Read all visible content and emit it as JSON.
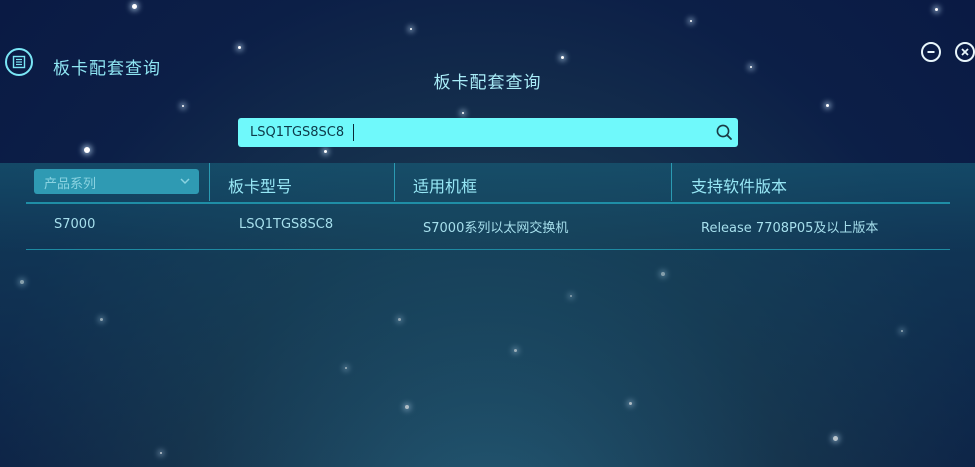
{
  "app": {
    "title": "板卡配套查询",
    "center_title": "板卡配套查询"
  },
  "search": {
    "value": "LSQ1TGS8SC8"
  },
  "filter": {
    "label": "产品系列"
  },
  "table": {
    "headers": [
      "板卡型号",
      "适用机框",
      "支持软件版本"
    ],
    "rows": [
      [
        "S7000",
        "LSQ1TGS8SC8",
        "S7000系列以太网交换机",
        "Release 7708P05及以上版本"
      ]
    ]
  },
  "icons": {
    "app": "list-icon",
    "search": "search-icon",
    "minimize": "minimize-icon",
    "close": "close-icon",
    "dropdown": "chevron-down-icon"
  },
  "colors": {
    "accent": "#6ff9fb",
    "text": "#97e7f5"
  }
}
